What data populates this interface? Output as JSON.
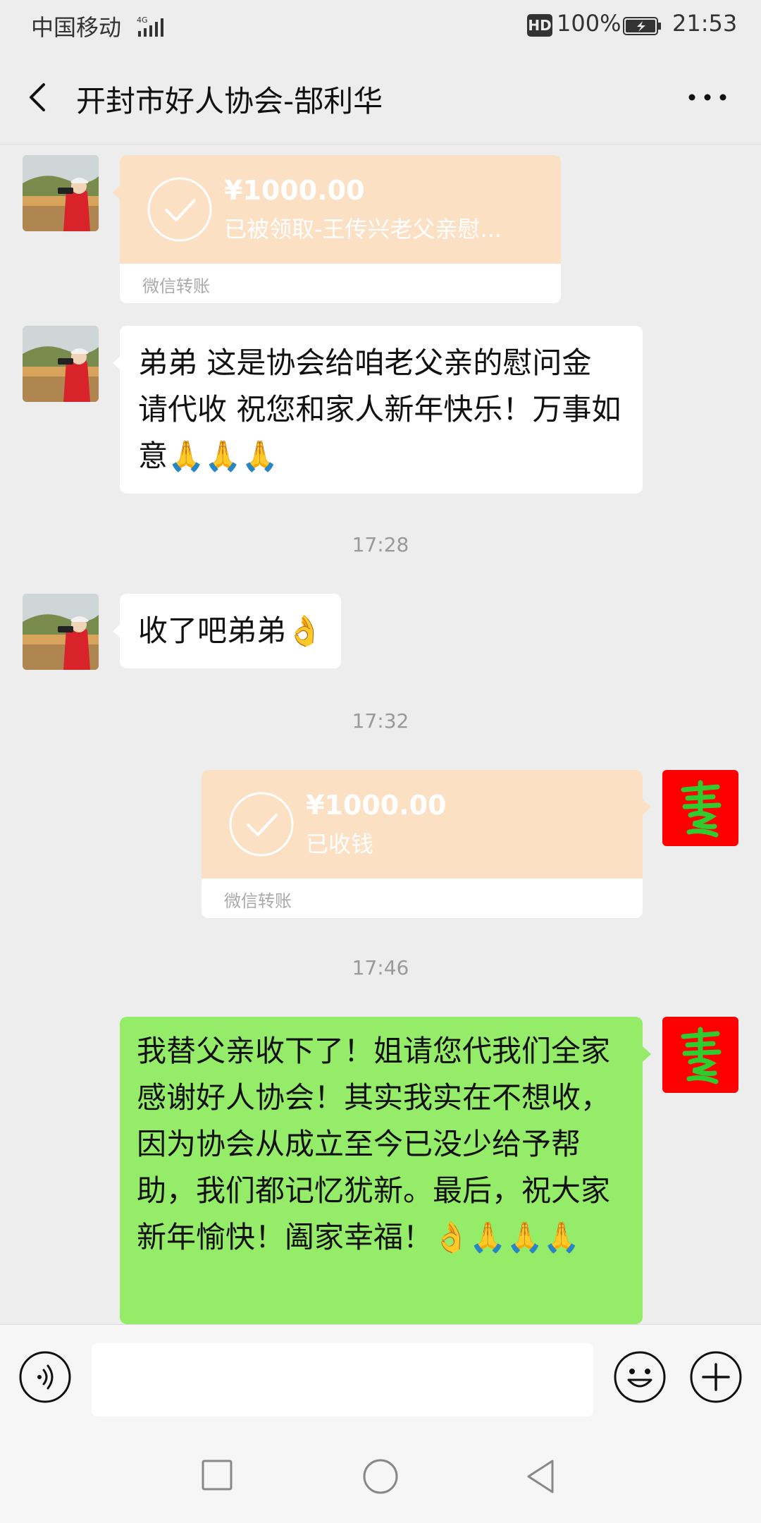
{
  "status_bar": {
    "carrier": "中国移动",
    "network": "4G",
    "hd": "HD",
    "battery": "100%",
    "time": "21:53"
  },
  "header": {
    "title": "开封市好人协会-郜利华",
    "back_icon": "chevron-left-icon",
    "more_icon": "more-dots-icon"
  },
  "messages": [
    {
      "type": "transfer",
      "side": "left",
      "amount": "¥1000.00",
      "description": "已被领取-王传兴老父亲慰...",
      "label": "微信转账"
    },
    {
      "type": "text",
      "side": "left",
      "text": "弟弟  这是协会给咱老父亲的慰问金  请代收  祝您和家人新年快乐！万事如意🙏🙏🙏"
    },
    {
      "type": "time",
      "text": "17:28"
    },
    {
      "type": "text",
      "side": "left",
      "text": "收了吧弟弟👌"
    },
    {
      "type": "time",
      "text": "17:32"
    },
    {
      "type": "transfer",
      "side": "right",
      "amount": "¥1000.00",
      "description": "已收钱",
      "label": "微信转账"
    },
    {
      "type": "time",
      "text": "17:46"
    },
    {
      "type": "text",
      "side": "right",
      "text": "我替父亲收下了！姐请您代我们全家感谢好人协会！其实我实在不想收，因为协会从成立至今已没少给予帮助，我们都记忆犹新。最后，祝大家新年愉快！阖家幸福！👌🙏🙏🙏"
    }
  ],
  "input_bar": {
    "placeholder": "",
    "voice_icon": "voice-icon",
    "emoji_icon": "emoji-icon",
    "plus_icon": "plus-icon"
  },
  "colors": {
    "background": "#ededed",
    "bubble_green": "#95ec69",
    "transfer_peach": "#fce0c4",
    "my_avatar": "#ff0000"
  }
}
